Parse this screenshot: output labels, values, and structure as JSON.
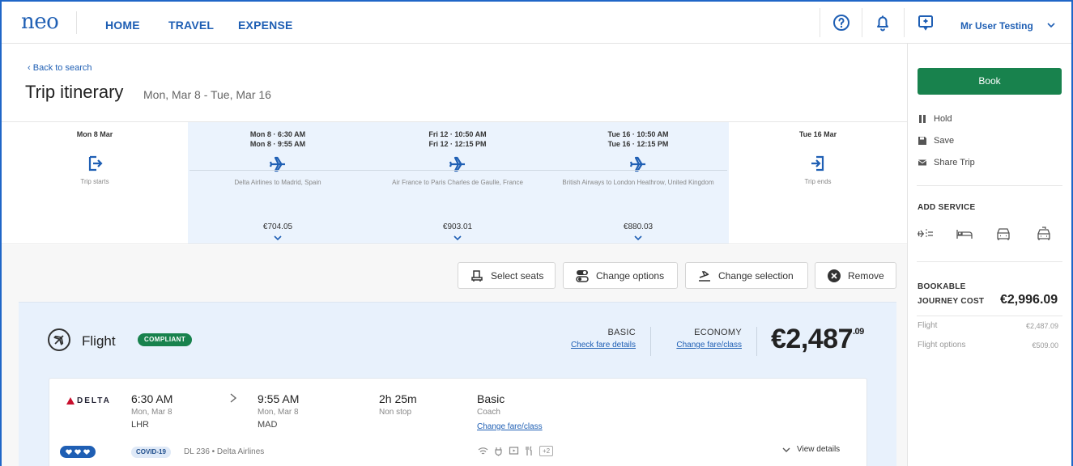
{
  "brand": {
    "logo": "neo"
  },
  "nav": {
    "items": [
      "HOME",
      "TRAVEL",
      "EXPENSE"
    ],
    "user": "Mr User Testing"
  },
  "header": {
    "back_link": "Back to search",
    "title": "Trip itinerary",
    "dates": "Mon, Mar 8 - Tue, Mar 16"
  },
  "timeline": {
    "start": {
      "date": "Mon 8 Mar",
      "label": "Trip starts"
    },
    "segments": [
      {
        "line1": "Mon 8 · 6:30 AM",
        "line2": "Mon 8 · 9:55 AM",
        "desc": "Delta Airlines to Madrid, Spain",
        "price": "€704.05"
      },
      {
        "line1": "Fri 12 · 10:50 AM",
        "line2": "Fri 12 · 12:15 PM",
        "desc": "Air France to Paris Charles de Gaulle, France",
        "price": "€903.01"
      },
      {
        "line1": "Tue 16 · 10:50 AM",
        "line2": "Tue 16 · 12:15 PM",
        "desc": "British Airways to London Heathrow, United Kingdom",
        "price": "€880.03"
      }
    ],
    "end": {
      "date": "Tue 16 Mar",
      "label": "Trip ends"
    }
  },
  "actions": {
    "select_seats": "Select seats",
    "change_options": "Change options",
    "change_selection": "Change selection",
    "remove": "Remove"
  },
  "flight": {
    "label": "Flight",
    "badge": "COMPLIANT",
    "fare_basic": "BASIC",
    "fare_basic_link": "Check fare details",
    "fare_class": "ECONOMY",
    "fare_class_link": "Change fare/class",
    "price_main": "€2,487",
    "price_cents": ".09"
  },
  "segment": {
    "airline_logo": "DELTA",
    "depart_time": "6:30 AM",
    "depart_date": "Mon, Mar 8",
    "depart_code": "LHR",
    "arrive_time": "9:55 AM",
    "arrive_date": "Mon, Mar 8",
    "arrive_code": "MAD",
    "duration": "2h 25m",
    "stops": "Non stop",
    "fare": "Basic",
    "cabin": "Coach",
    "fare_link": "Change fare/class",
    "covid": "COVID-19",
    "flight_no": "DL 236 • Delta Airlines",
    "amenities_more": "+2",
    "view_details": "View details"
  },
  "sidebar": {
    "book": "Book",
    "hold": "Hold",
    "save": "Save",
    "share": "Share Trip",
    "add_service": "ADD SERVICE",
    "bookable_line1": "BOOKABLE",
    "bookable_line2": "JOURNEY COST",
    "bookable_value": "€2,996.09",
    "rows": [
      {
        "label": "Flight",
        "value": "€2,487.09"
      },
      {
        "label": "Flight options",
        "value": "€509.00"
      }
    ]
  },
  "colors": {
    "brand_blue": "#1f5fb4",
    "green": "#18824d",
    "selected_bg": "#ebf3fd"
  }
}
